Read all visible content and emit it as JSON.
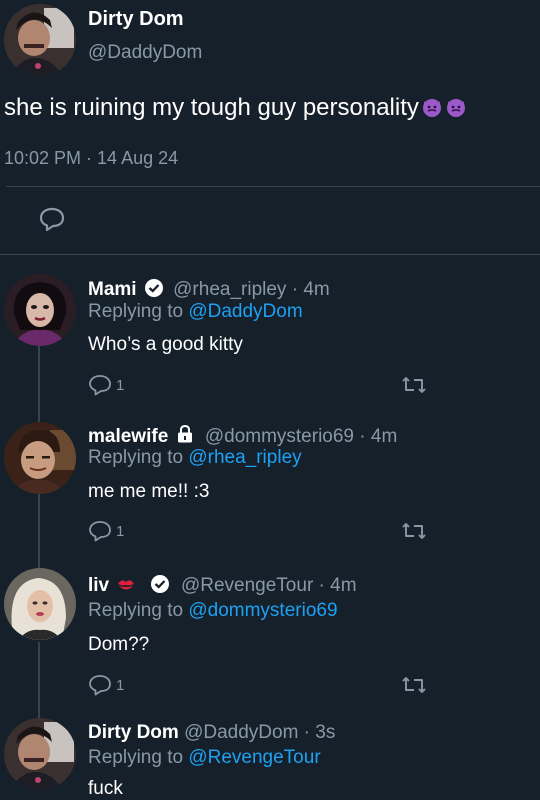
{
  "main_tweet": {
    "display_name": "Dirty Dom",
    "handle": "@DaddyDom",
    "text": "she is ruining my tough guy personality",
    "emoji": [
      "devil-face-icon",
      "devil-face-icon"
    ],
    "timestamp": "10:02 PM · 14 Aug 24"
  },
  "replies": [
    {
      "display_name": "Mami",
      "badge": "verified-icon",
      "handle": "@rhea_ripley",
      "time": "4m",
      "replying_prefix": "Replying to",
      "replying_to": "@DaddyDom",
      "text": "Who’s a good kitty",
      "reply_count": "1"
    },
    {
      "display_name": "malewife",
      "badge": "lock-icon",
      "handle": "@dommysterio69",
      "time": "4m",
      "replying_prefix": "Replying to",
      "replying_to": "@rhea_ripley",
      "text": "me me me!! :3",
      "reply_count": "1"
    },
    {
      "display_name": "liv",
      "badge": "verified-icon",
      "handle": "@RevengeTour",
      "time": "4m",
      "replying_prefix": "Replying to",
      "replying_to": "@dommysterio69",
      "text": "Dom??",
      "reply_count": "1"
    },
    {
      "display_name": "Dirty Dom",
      "handle": "@DaddyDom",
      "time": "3s",
      "replying_prefix": "Replying to",
      "replying_to": "@RevengeTour",
      "text": "fuck"
    }
  ],
  "colors": {
    "background": "#15202b",
    "muted": "#8899a6",
    "link": "#1da1f2",
    "divider": "#38444d"
  }
}
